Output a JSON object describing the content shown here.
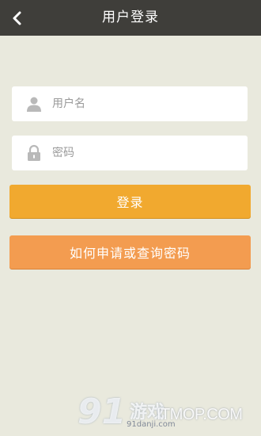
{
  "header": {
    "title": "用户登录",
    "back_icon": "chevron-left-icon"
  },
  "form": {
    "username": {
      "placeholder": "用户名",
      "value": "",
      "icon": "user-icon"
    },
    "password": {
      "placeholder": "密码",
      "value": "",
      "icon": "lock-icon"
    }
  },
  "buttons": {
    "login_label": "登录",
    "help_label": "如何申请或查询密码"
  },
  "watermark": {
    "logo_number": "91",
    "brand": "游戏",
    "domain_small": "91danji.com",
    "domain_large": "ITMOP.COM"
  },
  "colors": {
    "topbar": "#3f3e3a",
    "background": "#e9e9dd",
    "login_button": "#f1a92f",
    "help_button": "#f39c50"
  }
}
